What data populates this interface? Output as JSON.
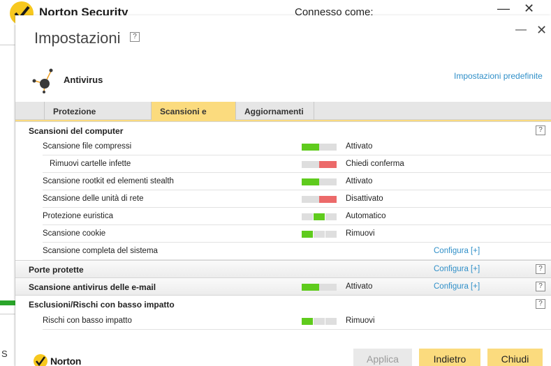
{
  "background_window": {
    "title": "Norton Security",
    "connected_as": "Connesso come:",
    "corner_letter": "S"
  },
  "dialog": {
    "title": "Impostazioni",
    "help_symbol": "?",
    "feature": "Antivirus",
    "defaults_link": "Impostazioni predefinite"
  },
  "tabs": [
    {
      "label": "Protezione automatica",
      "active": false
    },
    {
      "label": "Scansioni e rischi",
      "active": true
    },
    {
      "label": "Aggiornamenti",
      "active": false
    }
  ],
  "sections": {
    "computer_scans": "Scansioni del computer",
    "protected_ports": "Porte protette",
    "email_scan": "Scansione antivirus delle e-mail",
    "exclusions": "Esclusioni/Rischi con basso impatto"
  },
  "rows": [
    {
      "label": "Scansione file compressi",
      "state": "Attivato",
      "toggle": "on"
    },
    {
      "label": "Rimuovi cartelle infette",
      "state": "Chiedi conferma",
      "toggle": "off"
    },
    {
      "label": "Scansione rootkit ed elementi stealth",
      "state": "Attivato",
      "toggle": "on"
    },
    {
      "label": "Scansione delle unità di rete",
      "state": "Disattivato",
      "toggle": "off"
    },
    {
      "label": "Protezione euristica",
      "state": "Automatico",
      "toggle": "middle"
    },
    {
      "label": "Scansione cookie",
      "state": "Rimuovi",
      "toggle": "three-left"
    },
    {
      "label": "Scansione completa del sistema",
      "configure": "Configura [+]"
    }
  ],
  "protected_ports_configure": "Configura [+]",
  "email_scan_row": {
    "state": "Attivato",
    "toggle": "on",
    "configure": "Configura [+]"
  },
  "exclusions_rows": [
    {
      "label": "Rischi con basso impatto",
      "state": "Rimuovi",
      "toggle": "three-left"
    }
  ],
  "footer": {
    "brand": "Norton",
    "apply": "Applica",
    "back": "Indietro",
    "close": "Chiudi"
  },
  "colors": {
    "accent_yellow": "#fbdb7e",
    "toggle_green": "#5fcb1d",
    "toggle_red": "#ec6a6a",
    "link_blue": "#2f8fc8",
    "brand_yellow": "#f7c81e"
  }
}
